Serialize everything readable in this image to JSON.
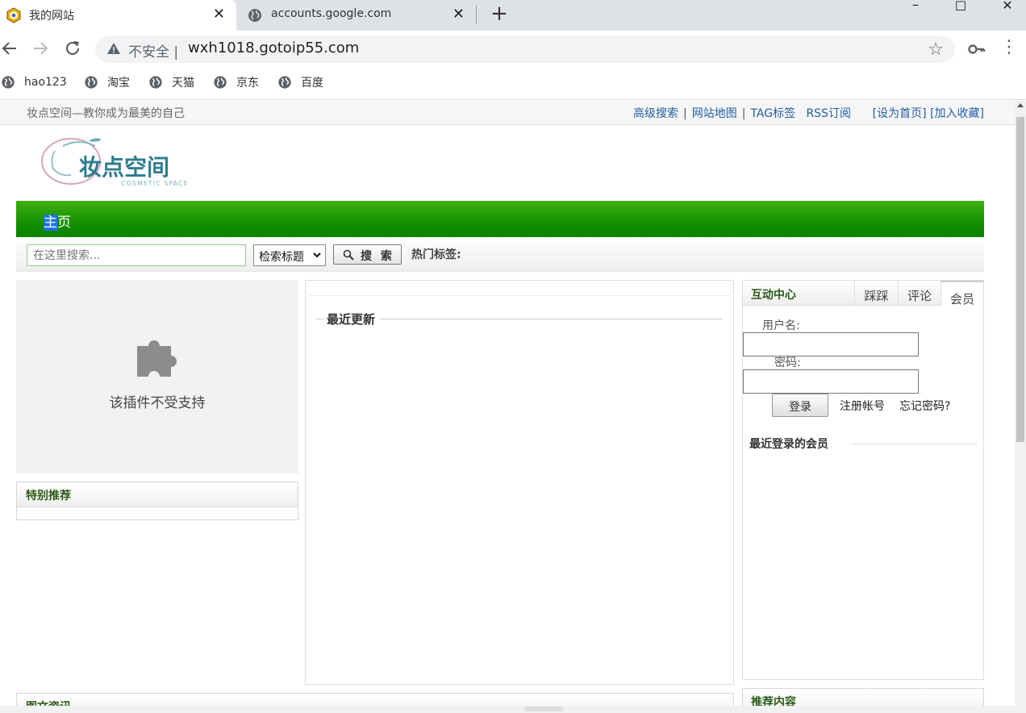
{
  "browser": {
    "tabs": [
      {
        "title": "我的网站",
        "active": true
      },
      {
        "title": "accounts.google.com",
        "active": false
      }
    ],
    "new_tab": "+",
    "omnibox": {
      "security_label": "不安全",
      "separator": "|",
      "url": "wxh1018.gotoip55.com"
    },
    "bookmarks": [
      "hao123",
      "淘宝",
      "天猫",
      "京东",
      "百度"
    ]
  },
  "page": {
    "slogan": "妆点空间—教你成为最美的自己",
    "top_links": [
      "高级搜索",
      "网站地图",
      "TAG标签",
      "RSS订阅"
    ],
    "set_home": "[设为首页]",
    "add_fav": "[加入收藏]",
    "logo": {
      "main": "妆点空间",
      "sub": "COSMETIC SPACE"
    },
    "nav": {
      "home_first": "主",
      "home_rest": "页"
    },
    "search": {
      "placeholder": "在这里搜索...",
      "select_value": "检索标题",
      "button": "搜 索",
      "hot_tags": "热门标签:"
    },
    "plugin_message": "该插件不受支持",
    "special_recommend": "特别推荐",
    "recent_updates": "最近更新",
    "interact": {
      "title": "互动中心",
      "tabs": [
        "踩踩",
        "评论",
        "会员"
      ],
      "username_label": "用户名:",
      "password_label": "密码:",
      "login_button": "登录",
      "register_link": "注册帐号",
      "forgot_link": "忘记密码?",
      "recent_members": "最近登录的会员"
    },
    "bottom_left_title": "图文资讯",
    "bottom_right_title": "推荐内容"
  },
  "colors": {
    "nav_green": "#159000",
    "link_blue": "#225ea3",
    "heading_green": "#2b5a16"
  }
}
